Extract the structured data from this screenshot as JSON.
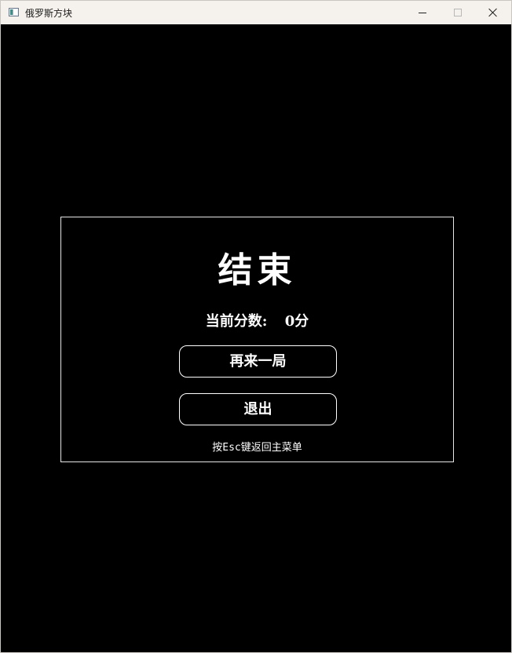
{
  "window": {
    "title": "俄罗斯方块",
    "icons": {
      "app": "app-window-icon",
      "minimize": "minimize-icon",
      "maximize": "maximize-icon",
      "close": "close-icon"
    }
  },
  "dialog": {
    "title": "结束",
    "score_label": "当前分数:",
    "score_value": "0分",
    "restart_label": "再来一局",
    "exit_label": "退出",
    "hint": "按Esc键返回主菜单"
  },
  "colors": {
    "background": "#000000",
    "foreground": "#ffffff",
    "titlebar": "#f5f1ec"
  }
}
